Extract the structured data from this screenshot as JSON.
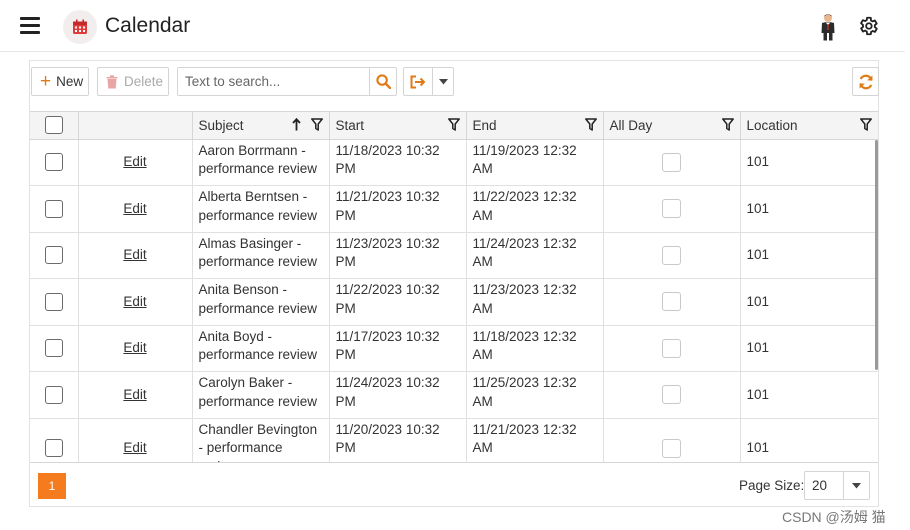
{
  "header": {
    "title": "Calendar",
    "menu_icon": "hamburger-icon",
    "logo_icon": "calendar-icon",
    "avatar_icon": "user-avatar",
    "settings_icon": "gear-icon"
  },
  "toolbar": {
    "new_label": "New",
    "delete_label": "Delete",
    "search_placeholder": "Text to search...",
    "search_value": "",
    "accent_color": "#e07a16"
  },
  "grid": {
    "columns": [
      {
        "key": "check",
        "label": ""
      },
      {
        "key": "edit",
        "label": ""
      },
      {
        "key": "subject",
        "label": "Subject",
        "sort": "ascending",
        "filter": true
      },
      {
        "key": "start",
        "label": "Start",
        "filter": true
      },
      {
        "key": "end",
        "label": "End",
        "filter": true
      },
      {
        "key": "allday",
        "label": "All Day",
        "filter": true
      },
      {
        "key": "location",
        "label": "Location",
        "filter": true
      }
    ],
    "edit_label": "Edit",
    "rows": [
      {
        "subject": "Aaron Borrmann - performance review",
        "start": "11/18/2023 10:32 PM",
        "end": "11/19/2023 12:32 AM",
        "allday": false,
        "location": "101"
      },
      {
        "subject": "Alberta Berntsen - performance review",
        "start": "11/21/2023 10:32 PM",
        "end": "11/22/2023 12:32 AM",
        "allday": false,
        "location": "101"
      },
      {
        "subject": "Almas Basinger - performance review",
        "start": "11/23/2023 10:32 PM",
        "end": "11/24/2023 12:32 AM",
        "allday": false,
        "location": "101"
      },
      {
        "subject": "Anita Benson - performance review",
        "start": "11/22/2023 10:32 PM",
        "end": "11/23/2023 12:32 AM",
        "allday": false,
        "location": "101"
      },
      {
        "subject": "Anita Boyd - performance review",
        "start": "11/17/2023 10:32 PM",
        "end": "11/18/2023 12:32 AM",
        "allday": false,
        "location": "101"
      },
      {
        "subject": "Carolyn Baker - performance review",
        "start": "11/24/2023 10:32 PM",
        "end": "11/25/2023 12:32 AM",
        "allday": false,
        "location": "101"
      },
      {
        "subject": "Chandler Bevington - performance review",
        "start": "11/20/2023 10:32 PM",
        "end": "11/21/2023 12:32 AM",
        "allday": false,
        "location": "101"
      }
    ]
  },
  "pager": {
    "current_page": "1",
    "page_size_label": "Page Size:",
    "page_size": "20",
    "accent_color": "#f57b1f"
  },
  "watermark": "CSDN @汤姆 猫"
}
